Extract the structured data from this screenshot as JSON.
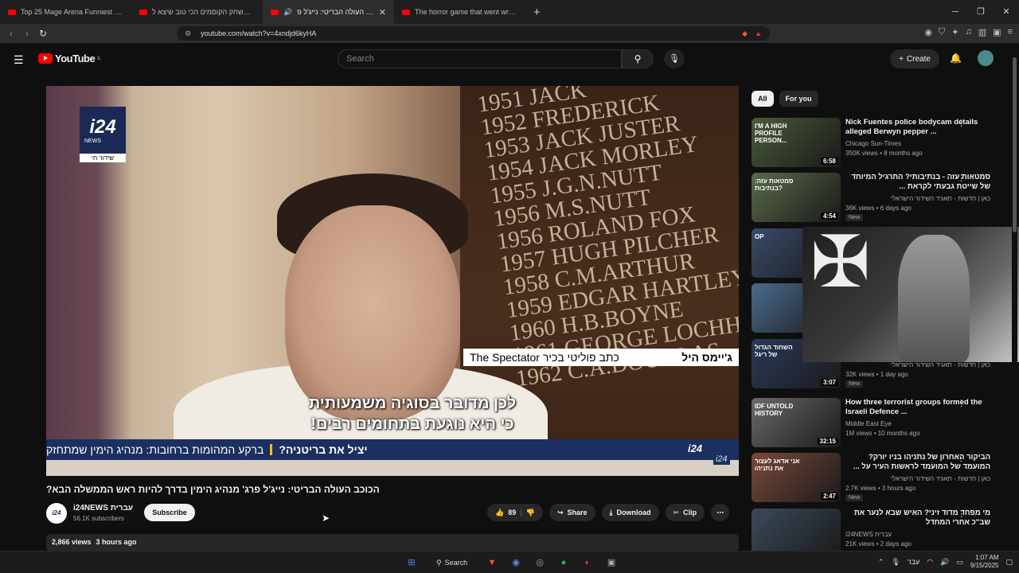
{
  "browser": {
    "tabs": [
      {
        "title": "Top 25 Mage Arena Funniest Momen",
        "active": false
      },
      {
        "title": "זה משחק הקוסמים הכי טוב שיצא ל",
        "active": false
      },
      {
        "title": "הכוכב העולה הבריטי: נייג'ל פ",
        "active": true
      },
      {
        "title": "The horror game that went wrong wi",
        "active": false
      }
    ],
    "url": "youtube.com/watch?v=4xndjd6kyHA"
  },
  "youtube": {
    "logo": "YouTube",
    "country": "IL",
    "search_placeholder": "Search",
    "create_label": "Create"
  },
  "video": {
    "channel_logo": "i24",
    "channel_logo_sub": "NEWS",
    "live_label": "שידור חי",
    "honours_board": [
      "1951 JACK",
      "1952 FREDERICK",
      "1953 JACK JUSTER",
      "1954 JACK MORLEY",
      "1955 J.G.N.NUTT",
      "1956 M.S.NUTT",
      "1956 ROLAND FOX",
      "1957 HUGH PILCHER",
      "1958 C.M.ARTHUR",
      "1959 EDGAR HARTLEY",
      "1960 H.B.BOYNE",
      "1961 GEORGE LOCHH",
      "1962 C.A.DOUGLAS"
    ],
    "nameplate_name": "ג'יימס היל",
    "nameplate_role": "כתב פוליטי בכיר The Spectator",
    "caption_line1": "לכן מדובר בסוגיה משמעותית",
    "caption_line2": "כי היא נוגעת בתחומים רבים!",
    "ticker_bold": "יציל את בריטניה?",
    "ticker_text": "ברקע המהומות ברחובות: מנהיג הימין שמתחזק",
    "ticker_logo": "i24",
    "watermark": "i24",
    "title": "הכוכב העולה הבריטי: נייג'ל פרג' מנהיג הימין בדרך להיות ראש הממשלה הבא?",
    "channel_name": "i24NEWS עברית",
    "subscribers": "56.1K subscribers",
    "subscribe_label": "Subscribe",
    "likes": "89",
    "share_label": "Share",
    "download_label": "Download",
    "clip_label": "Clip",
    "views": "2,866 views",
    "age": "3 hours ago"
  },
  "chips": [
    "All",
    "For you"
  ],
  "recommendations": [
    {
      "title": "Nick Fuentes police bodycam details alleged Berwyn pepper ...",
      "channel": "Chicago Sun-Times",
      "meta": "350K views • 8 months ago",
      "duration": "6:58",
      "new": false,
      "thumb_text": "I'M A HIGH PROFILE PERSON...",
      "thumb_color": "#4a5a3a"
    },
    {
      "title": "סמטאות עזה - בנתיבותי? התרגיל המיוחד של שייטת גבעתי לקראת ...",
      "channel": "כאן | חדשות - תאגיד השידור הישראלי",
      "meta": "36K views • 6 days ago",
      "duration": "4:54",
      "new": true,
      "thumb_text": "סמטאות עזה: בנתיבות?",
      "thumb_color": "#5a6a4a"
    },
    {
      "title": "",
      "channel": "",
      "meta": "",
      "duration": "",
      "new": false,
      "thumb_text": "OP",
      "thumb_color": "#3a4a6a"
    },
    {
      "title": "",
      "channel": "",
      "meta": "",
      "duration": "",
      "new": false,
      "thumb_text": "",
      "thumb_color": "#4a6a8a"
    },
    {
      "title": "",
      "channel": "כאן | חדשות - תאגיד השידור הישראלי",
      "meta": "32K views • 1 day ago",
      "duration": "3:07",
      "new": true,
      "thumb_text": "השחוד הגדול של ריגל",
      "thumb_color": "#2a3a5a"
    },
    {
      "title": "How three terrorist groups formed the Israeli Defence ...",
      "channel": "Middle East Eye",
      "meta": "1M views • 10 months ago",
      "duration": "32:15",
      "new": false,
      "thumb_text": "IDF UNTOLD HISTORY",
      "thumb_color": "#6a6a6a"
    },
    {
      "title": "הביקור האחרון של נתניהו בניו יורק? המועמד של המועמד לראשות העיר על ...",
      "channel": "כאן | חדשות - תאגיד השידור הישראלי",
      "meta": "2.7K views • 3 hours ago",
      "duration": "2:47",
      "new": true,
      "thumb_text": "אני אדאג לעצור את נתניהו",
      "thumb_color": "#7a4a3a"
    },
    {
      "title": "מי מפחד מדוד זיני? האיש שבא לנער את שב\"כ אחרי המחדל",
      "channel": "i24NEWS עברית",
      "meta": "21K views • 2 days ago",
      "duration": "",
      "new": false,
      "thumb_text": "",
      "thumb_color": "#3a4a5a"
    }
  ],
  "overlay": {
    "cross": "✠"
  },
  "taskbar": {
    "search_label": "Search",
    "language": "עבר",
    "time": "1:07 AM",
    "date": "9/15/2025"
  },
  "colors": {
    "accent": "#ff0000",
    "background": "#0f0f0f",
    "ticker": "#1b3060"
  }
}
